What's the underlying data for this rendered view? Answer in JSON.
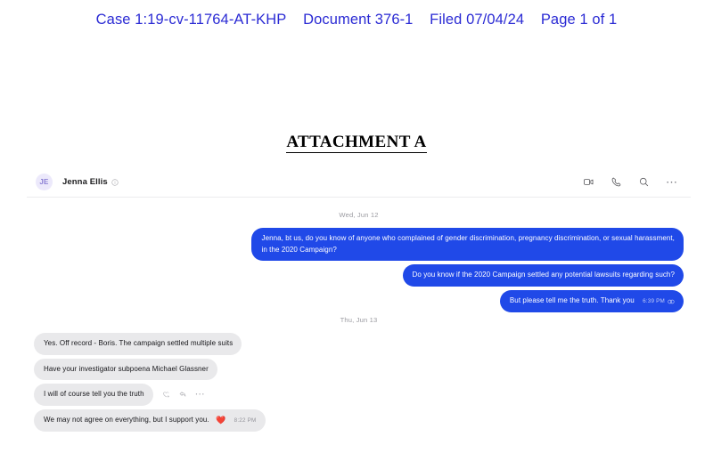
{
  "court_stamp": {
    "case": "Case 1:19-cv-11764-AT-KHP",
    "document": "Document 376-1",
    "filed": "Filed 07/04/24",
    "page": "Page 1 of 1"
  },
  "exhibit": {
    "title": "ATTACHMENT A"
  },
  "chat": {
    "header": {
      "avatar_initials": "JE",
      "contact_name": "Jenna Ellis",
      "info_icon": "info-circle-icon",
      "actions": [
        {
          "name": "video-call-icon",
          "label": "Video call"
        },
        {
          "name": "audio-call-icon",
          "label": "Audio call"
        },
        {
          "name": "search-icon",
          "label": "Search"
        },
        {
          "name": "more-options-icon",
          "label": "More"
        }
      ]
    },
    "days": [
      {
        "divider": "Wed, Jun 12",
        "messages": [
          {
            "direction": "out",
            "line1": "Jenna, bt us, do you know of anyone who complained of gender discrimination, pregnancy discrimination, or sexual harassment,",
            "line2": "in the 2020 Campaign?",
            "timestamp": "",
            "read_receipt": false
          },
          {
            "direction": "out",
            "line1": "Do you know if the 2020 Campaign settled any potential lawsuits regarding such?",
            "line2": "",
            "timestamp": "",
            "read_receipt": false
          },
          {
            "direction": "out",
            "line1": "But please tell me the truth. Thank you",
            "line2": "",
            "timestamp": "6:39 PM",
            "read_receipt": true
          }
        ]
      },
      {
        "divider": "Thu, Jun 13",
        "messages": [
          {
            "direction": "in",
            "line1": "Yes. Off record - Boris. The campaign settled multiple suits",
            "line2": "",
            "timestamp": "",
            "reaction": "",
            "hover_actions": false
          },
          {
            "direction": "in",
            "line1": "Have your investigator subpoena Michael Glassner",
            "line2": "",
            "timestamp": "",
            "reaction": "",
            "hover_actions": false
          },
          {
            "direction": "in",
            "line1": "I will of course tell you the truth",
            "line2": "",
            "timestamp": "",
            "reaction": "",
            "hover_actions": true
          },
          {
            "direction": "in",
            "line1": "We may not agree on everything, but I support you.",
            "line2": "",
            "timestamp": "8:22 PM",
            "reaction": "❤️",
            "hover_actions": false
          }
        ]
      }
    ],
    "hover_action_icons": [
      {
        "name": "add-reaction-icon"
      },
      {
        "name": "reply-icon"
      },
      {
        "name": "more-actions-icon"
      }
    ],
    "colors": {
      "outgoing_bubble": "#2049e8",
      "incoming_bubble": "#e9e9eb",
      "stamp_blue": "#2a2ad4",
      "avatar_bg": "#ece9fb"
    }
  }
}
